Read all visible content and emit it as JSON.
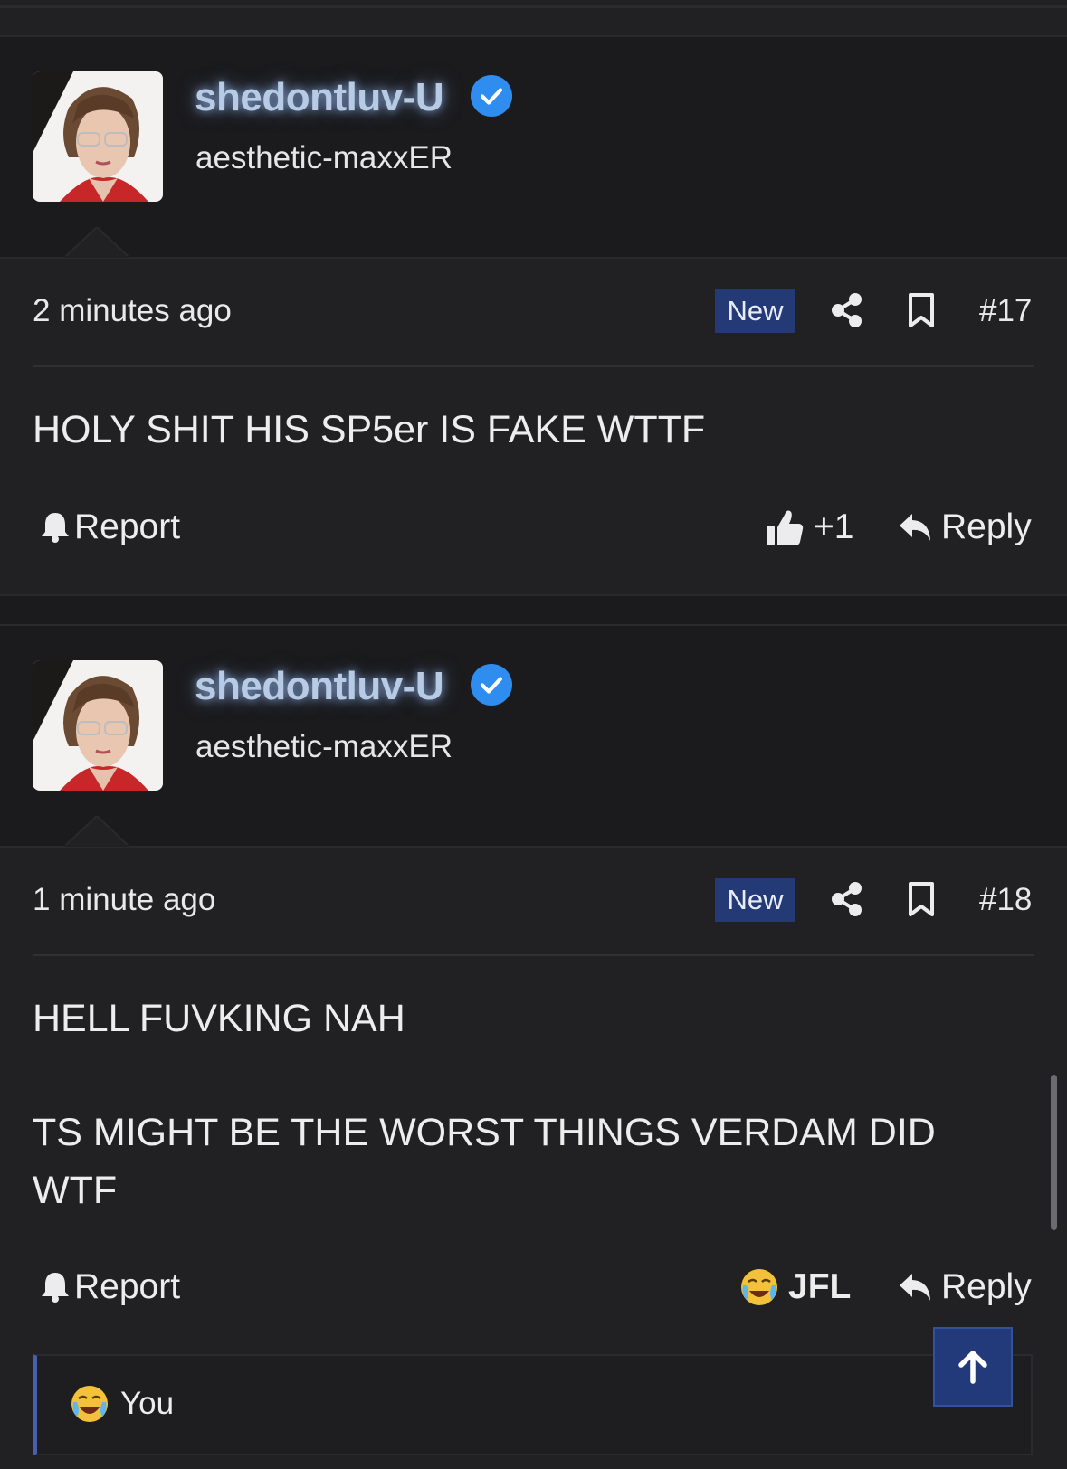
{
  "posts": [
    {
      "username": "shedontluv-U",
      "user_title": "aesthetic-maxxER",
      "time": "2 minutes ago",
      "badge": "New",
      "post_number": "#17",
      "body_lines": [
        "HOLY SHIT HIS SP5er IS FAKE WTTF"
      ],
      "report_label": "Report",
      "reaction_icon": "thumbs-up-icon",
      "reaction_label": "+1",
      "reply_label": "Reply"
    },
    {
      "username": "shedontluv-U",
      "user_title": "aesthetic-maxxER",
      "time": "1 minute ago",
      "badge": "New",
      "post_number": "#18",
      "body_lines": [
        "HELL FUVKING NAH",
        "TS MIGHT BE THE WORST THINGS VERDAM DID",
        "WTF"
      ],
      "report_label": "Report",
      "reaction_icon": "crying-face-icon",
      "reaction_label": "JFL",
      "reply_label": "Reply"
    }
  ],
  "reactions_bar": {
    "emoji_icon": "crying-face-icon",
    "label": "You"
  },
  "colors": {
    "background": "#212123",
    "header_background": "#1b1b1d",
    "badge": "#243a77",
    "verified": "#2f8df0",
    "accent_bar": "#4a5fb0"
  }
}
